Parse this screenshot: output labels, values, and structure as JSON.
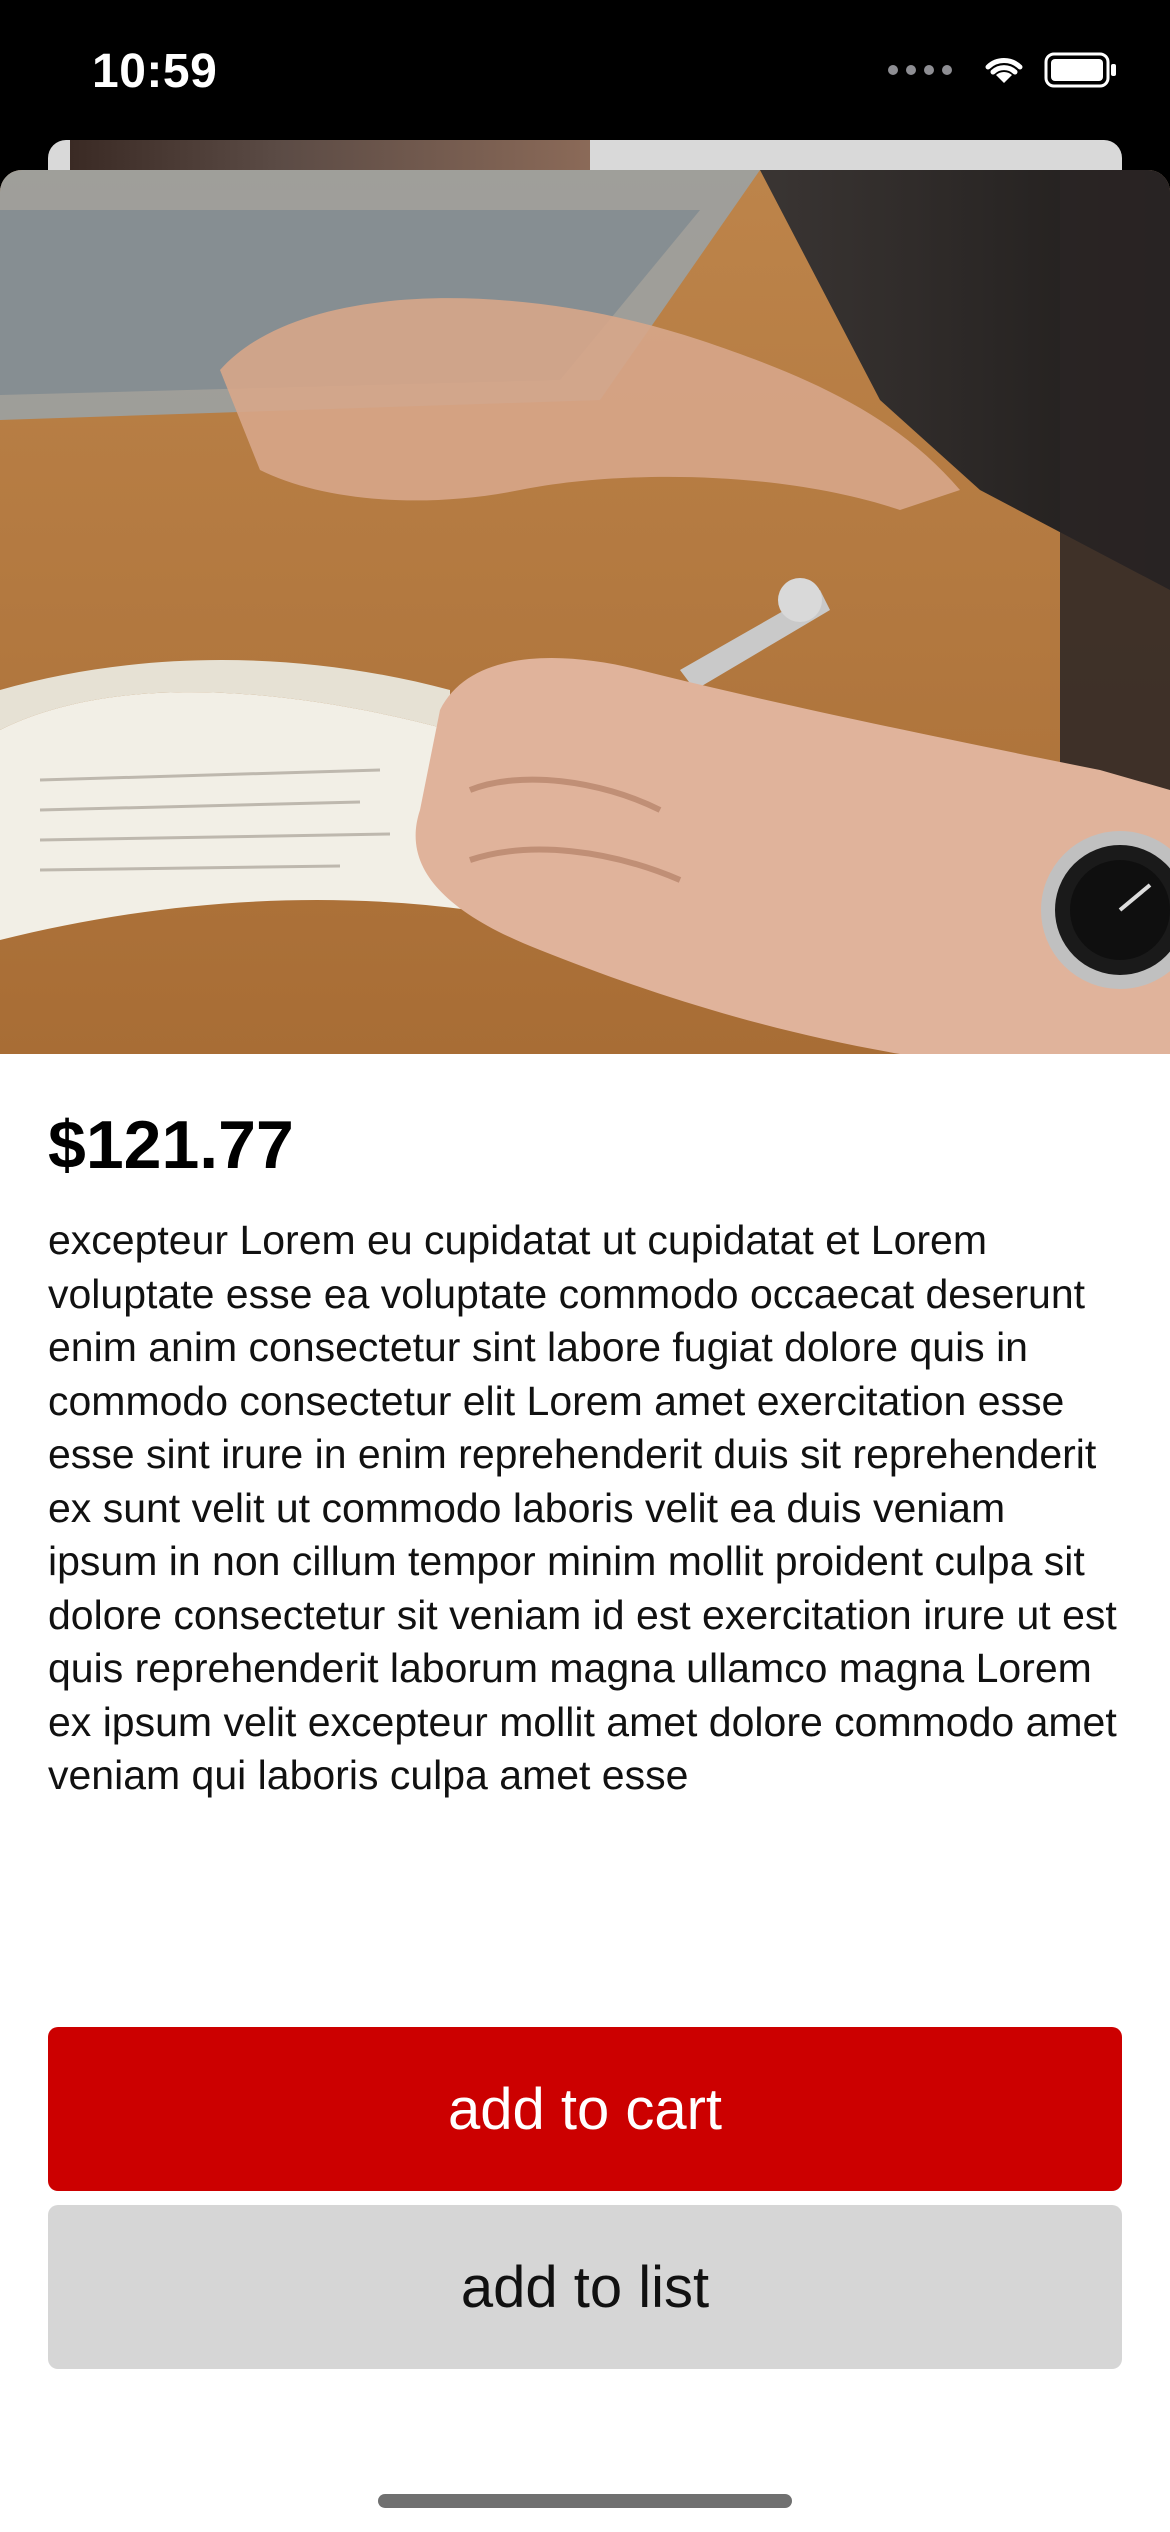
{
  "status_bar": {
    "time": "10:59",
    "icons": [
      "signal-dots-icon",
      "wifi-icon",
      "battery-icon"
    ]
  },
  "product": {
    "image_description_icon": "product-photo",
    "price": "$121.77",
    "description": "excepteur Lorem eu cupidatat ut cupidatat et Lorem voluptate esse ea voluptate commodo occaecat deserunt enim anim consectetur sint labore fugiat dolore quis in commodo consectetur elit Lorem amet exercitation esse esse sint irure in enim reprehenderit duis sit reprehenderit ex sunt velit ut commodo laboris velit ea duis veniam ipsum in non cillum tempor minim mollit proident culpa sit dolore consectetur sit veniam id est exercitation irure ut est quis reprehenderit laborum magna ullamco magna Lorem ex ipsum velit excepteur mollit amet dolore commodo amet veniam qui laboris culpa amet esse"
  },
  "actions": {
    "add_to_cart_label": "add to cart",
    "add_to_list_label": "add to list"
  },
  "colors": {
    "primary_button": "#cc0000",
    "secondary_button": "#d6d6d6"
  }
}
